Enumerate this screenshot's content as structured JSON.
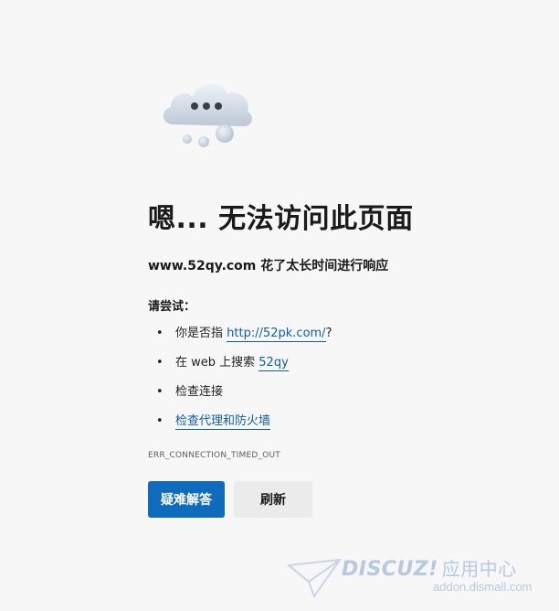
{
  "error_page": {
    "title": "嗯... 无法访问此页面",
    "subtitle": "www.52qy.com 花了太长时间进行响应",
    "try_label": "请尝试：",
    "suggestions": [
      {
        "prefix": "你是否指 ",
        "link": "http://52pk.com/",
        "suffix": "?"
      },
      {
        "prefix": "在 web 上搜索 ",
        "link": "52qy",
        "suffix": ""
      },
      {
        "prefix": "检查连接",
        "link": "",
        "suffix": ""
      },
      {
        "prefix": "",
        "link": "检查代理和防火墙",
        "suffix": ""
      }
    ],
    "error_code": "ERR_CONNECTION_TIMED_OUT",
    "buttons": {
      "troubleshoot": "疑难解答",
      "refresh": "刷新"
    }
  },
  "watermark": {
    "brand": "DISCUZ!",
    "brand_cn": "应用中心",
    "url": "addon.dismall.com"
  },
  "colors": {
    "background": "#f7f7f7",
    "link": "#0f5fa8",
    "primary_button": "#0f6cbd",
    "secondary_button": "#ebebeb",
    "watermark": "#b7c9e0"
  },
  "icons": {
    "error_illustration": "cloud-timeout-icon",
    "watermark_logo": "paper-plane-icon"
  }
}
